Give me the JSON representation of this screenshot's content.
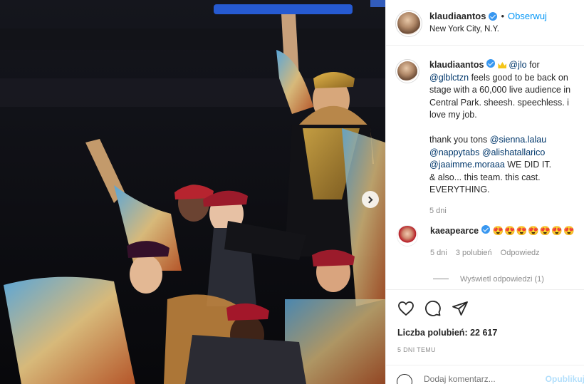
{
  "post": {
    "username": "klaudiaantos",
    "follow_label": "Obserwuj",
    "dot": "•",
    "location": "New York City, N.Y."
  },
  "caption": {
    "username": "klaudiaantos",
    "mention1": "@jlo",
    "for_text": " for ",
    "mention2": "@glblctzn",
    "line1": "feels good to be back on stage with a 60,000 live audience in Central Park. sheesh. speechless. i love my job.",
    "thanks": "thank you tons ",
    "mention3": "@sienna.lalau",
    "mention4": "@nappytabs",
    "mention5": "@alishatallarico",
    "mention6": "@jaaimme.moraaa",
    "did_it": " WE DID IT.",
    "line3": "& also... this team. this cast. EVERYTHING.",
    "time": "5 dni"
  },
  "comment": {
    "username": "kaeapearce",
    "text": "😍😍😍😍😍😍😍",
    "time": "5 dni",
    "likes": "3 polubień",
    "reply": "Odpowiedz",
    "view_replies": "Wyświetl odpowiedzi (1)"
  },
  "footer": {
    "likes": "Liczba polubień: 22 617",
    "ago": "5 DNI TEMU",
    "comment_placeholder": "Dodaj komentarz...",
    "publish": "Opublikuj"
  },
  "colors": {
    "accent": "#0095f6",
    "verified": "#3897f0",
    "muted": "#8e8e8e"
  }
}
